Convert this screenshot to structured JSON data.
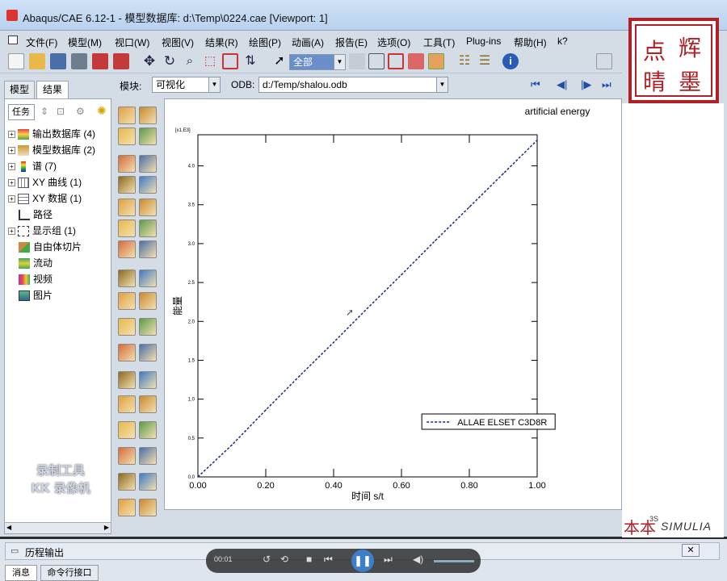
{
  "window": {
    "title": "Abaqus/CAE 6.12-1 - 模型数据库: d:\\Temp\\0224.cae [Viewport: 1]"
  },
  "menubar": {
    "items": [
      "文件(F)",
      "模型(M)",
      "视口(W)",
      "视图(V)",
      "结果(R)",
      "绘图(P)",
      "动画(A)",
      "报告(E)",
      "选项(O)",
      "工具(T)",
      "Plug-ins",
      "帮助(H)",
      "k?"
    ]
  },
  "toolbar": {
    "selection_filter": "全部"
  },
  "context": {
    "module_label": "模块:",
    "module_value": "可视化",
    "odb_label": "ODB:",
    "odb_value": "d:/Temp/shalou.odb"
  },
  "logo": {
    "chars": [
      "点",
      "辉",
      "晴",
      "墨"
    ]
  },
  "left_tabs": [
    "模型",
    "结果"
  ],
  "task_select": "任务",
  "tree": [
    {
      "label": "输出数据库 (4)",
      "expandable": true,
      "icon": "odb-icon"
    },
    {
      "label": "模型数据库 (2)",
      "expandable": true,
      "icon": "model-db-icon"
    },
    {
      "label": "谱 (7)",
      "expandable": true,
      "icon": "spectrum-icon"
    },
    {
      "label": "XY 曲线 (1)",
      "expandable": true,
      "icon": "xy-curve-icon"
    },
    {
      "label": "XY 数据 (1)",
      "expandable": true,
      "icon": "xy-data-icon"
    },
    {
      "label": "路径",
      "expandable": false,
      "icon": "path-icon"
    },
    {
      "label": "显示组 (1)",
      "expandable": true,
      "icon": "display-group-icon"
    },
    {
      "label": "自由体切片",
      "expandable": false,
      "icon": "free-body-icon"
    },
    {
      "label": "流动",
      "expandable": false,
      "icon": "stream-icon"
    },
    {
      "label": "视频",
      "expandable": false,
      "icon": "movie-icon"
    },
    {
      "label": "图片",
      "expandable": false,
      "icon": "image-icon"
    }
  ],
  "watermark": [
    "录制工具",
    "KK 录像机"
  ],
  "chart_data": {
    "type": "line",
    "title": "artificial energy",
    "xlabel": "时间 s/t",
    "ylabel": "能量",
    "y_multiplier": "[x1.E3]",
    "xlim": [
      0,
      1
    ],
    "ylim": [
      0,
      4.4
    ],
    "xticks": [
      "0.00",
      "0.20",
      "0.40",
      "0.60",
      "0.80",
      "1.00"
    ],
    "yticks": [
      "0.0",
      "0.5",
      "1.0",
      "1.5",
      "2.0",
      "2.5",
      "3.0",
      "3.5",
      "4.0"
    ],
    "series": [
      {
        "name": "ALLAE ELSET C3D8R",
        "color": "#1a2a80",
        "style": "dashed",
        "x": [
          0.0,
          0.1,
          0.2,
          0.3,
          0.4,
          0.5,
          0.6,
          0.7,
          0.8,
          0.9,
          1.0
        ],
        "y": [
          0.0,
          0.41,
          0.86,
          1.3,
          1.73,
          2.17,
          2.6,
          3.04,
          3.47,
          3.9,
          4.33
        ]
      }
    ],
    "legend_position": "bottom-right",
    "grid": false
  },
  "simulia": {
    "brand": "SIMULIA",
    "mark": "3S",
    "stamp": "本本"
  },
  "bottom": {
    "history_label": "历程输出",
    "tabs": [
      "消息",
      "命令行接口"
    ],
    "time": "00:01"
  }
}
